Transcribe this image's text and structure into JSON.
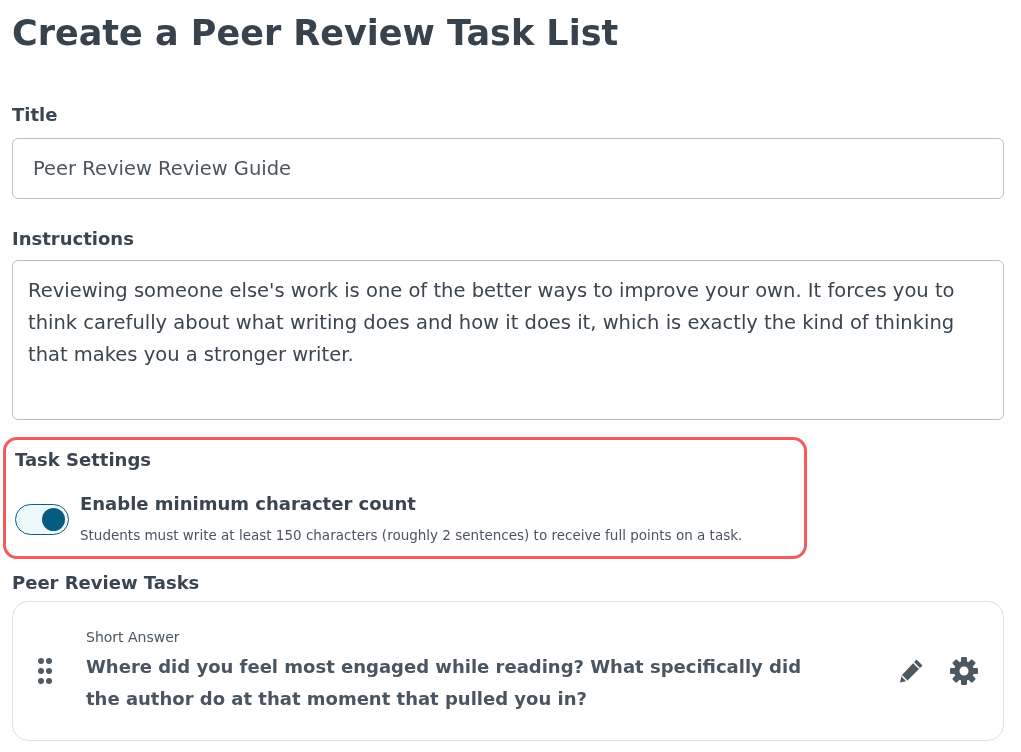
{
  "page": {
    "title": "Create a Peer Review Task List"
  },
  "title_field": {
    "label": "Title",
    "value": "Peer Review Review Guide"
  },
  "instructions_field": {
    "label": "Instructions",
    "value": "Reviewing someone else's work is one of the better ways to improve your own. It forces you to think carefully about what writing does and how it does it, which is exactly the kind of thinking that makes you a stronger writer."
  },
  "task_settings": {
    "heading": "Task Settings",
    "highlighted": true,
    "settings": [
      {
        "kind": "toggle",
        "label": "Enable minimum character count",
        "description": "Students must write at least 150 characters (roughly 2 sentences) to receive full points on a task.",
        "on": true
      }
    ]
  },
  "peer_review_tasks": {
    "heading": "Peer Review Tasks",
    "tasks": [
      {
        "category": "Short Answer",
        "question": "Where did you feel most engaged while reading? What specifically did the author do at that moment that pulled you in?"
      }
    ]
  }
}
